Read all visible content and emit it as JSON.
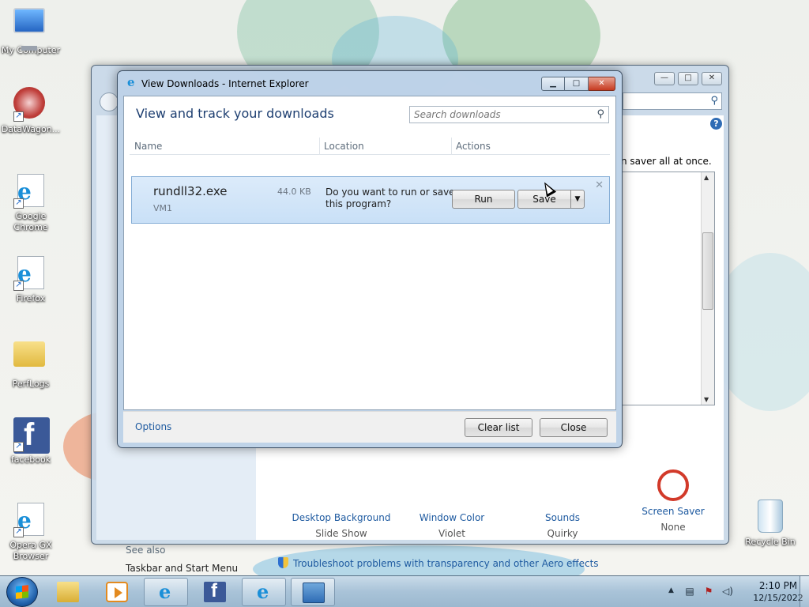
{
  "desktop": {
    "icons": [
      {
        "label": "My Computer"
      },
      {
        "label": "DataWagon..."
      },
      {
        "label": "Google Chrome"
      },
      {
        "label": "Firefox"
      },
      {
        "label": "PerfLogs"
      },
      {
        "label": "facebook"
      },
      {
        "label": "Opera GX Browser"
      },
      {
        "label": "Recycle Bin"
      }
    ]
  },
  "personalization": {
    "screen_saver_hint": "n saver all at once.",
    "items": [
      {
        "title": "Desktop Background",
        "subtitle": "Slide Show"
      },
      {
        "title": "Window Color",
        "subtitle": "Violet"
      },
      {
        "title": "Sounds",
        "subtitle": "Quirky"
      },
      {
        "title": "Screen Saver",
        "subtitle": "None"
      }
    ],
    "see_also": "See also",
    "taskbar_link": "Taskbar and Start Menu",
    "troubleshoot_link": "Troubleshoot problems with transparency and other Aero effects"
  },
  "downloads": {
    "window_title": "View Downloads - Internet Explorer",
    "heading": "View and track your downloads",
    "search_placeholder": "Search downloads",
    "columns": {
      "name": "Name",
      "location": "Location",
      "actions": "Actions"
    },
    "item": {
      "filename": "rundll32.exe",
      "size": "44.0 KB",
      "source": "VM1",
      "prompt": "Do you want to run or save this program?",
      "run_label": "Run",
      "save_label": "Save",
      "save_dropdown": "▼"
    },
    "options_label": "Options",
    "clear_list_label": "Clear list",
    "close_label": "Close"
  },
  "taskbar": {
    "time": "2:10 PM",
    "date": "12/15/2022"
  }
}
